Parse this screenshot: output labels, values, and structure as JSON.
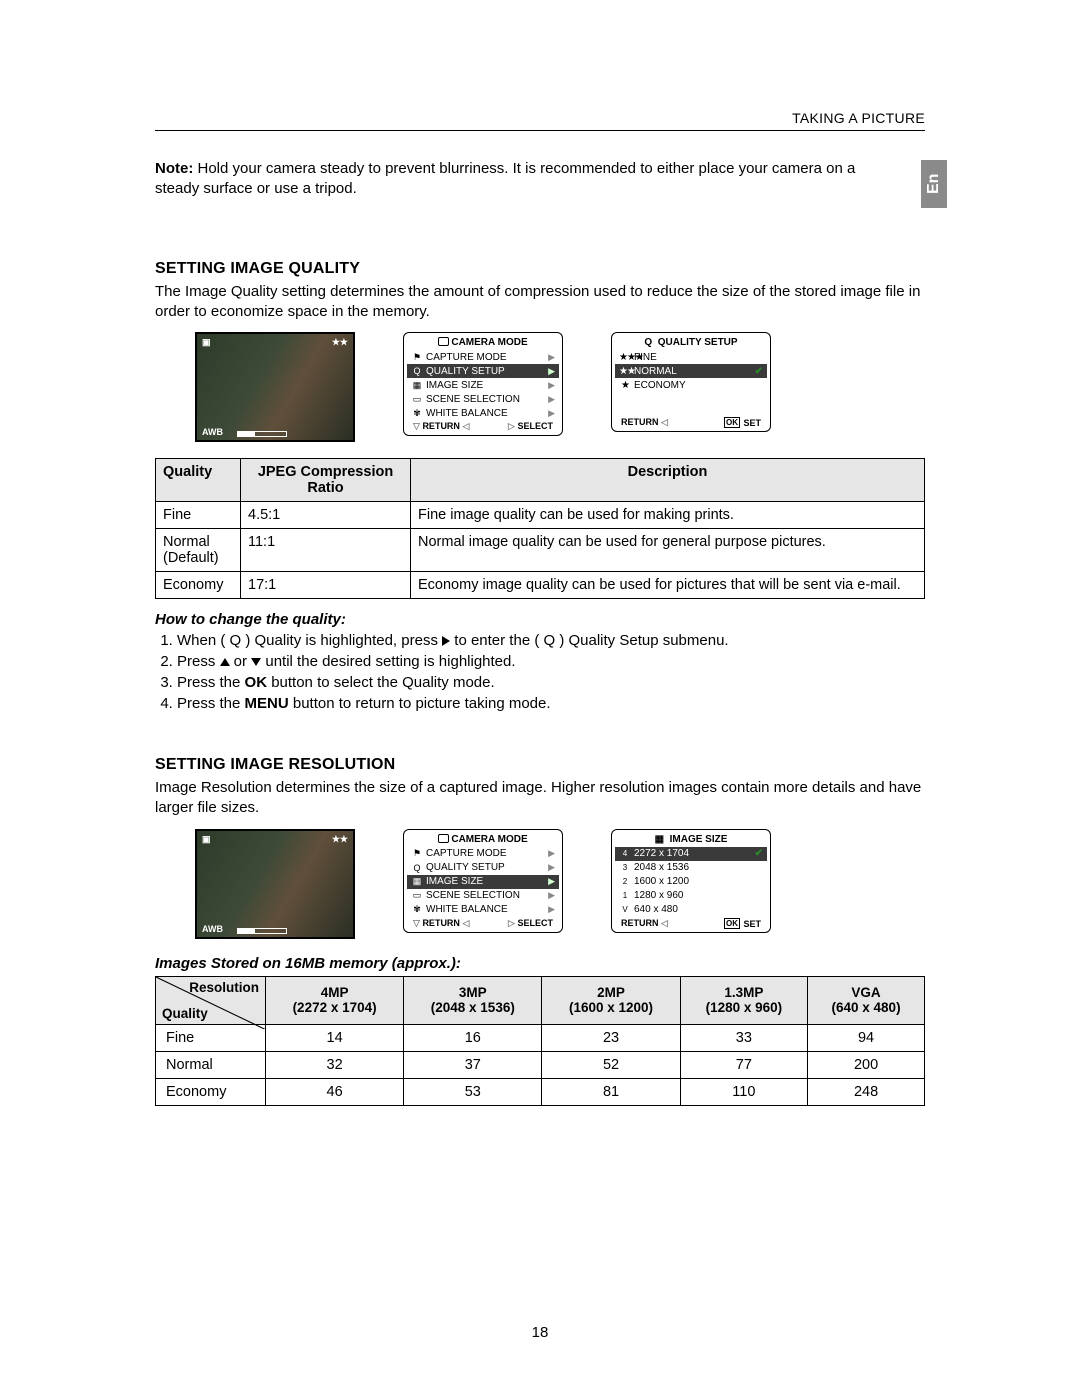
{
  "chapter": "TAKING A PICTURE",
  "lang_tab": "En",
  "note_prefix": "Note:",
  "note_text": " Hold your camera steady to prevent blurriness. It is recommended to either place your camera on a steady surface or use a tripod.",
  "section1_title": "SETTING IMAGE QUALITY",
  "section1_para": "The Image Quality setting determines the amount of compression used to reduce the size of the stored image file in order to economize space in the memory.",
  "lcd_photo": {
    "awb": "AWB",
    "top_left": "",
    "top_right": "★★"
  },
  "menu_camera_title": "CAMERA MODE",
  "menu_camera_items": [
    {
      "icon": "⚑",
      "label": "CAPTURE MODE"
    },
    {
      "icon": "Q",
      "label": "QUALITY SETUP"
    },
    {
      "icon": "▦",
      "label": "IMAGE SIZE"
    },
    {
      "icon": "▭",
      "label": "SCENE SELECTION"
    },
    {
      "icon": "✾",
      "label": "WHITE BALANCE"
    }
  ],
  "menu_camera_highlight_index": 1,
  "menu_foot_left": "RETURN",
  "menu_foot_right": "SELECT",
  "menu_foot_set": "SET",
  "quality_setup_title": "QUALITY  SETUP",
  "quality_setup_prefix": "Q",
  "quality_options": [
    {
      "stars": "★★★",
      "label": "FINE"
    },
    {
      "stars": "★★",
      "label": "NORMAL"
    },
    {
      "stars": "★",
      "label": "ECONOMY"
    }
  ],
  "quality_selected_index": 1,
  "quality_table": {
    "headers": [
      "Quality",
      "JPEG Compression Ratio",
      "Description"
    ],
    "rows": [
      {
        "q": "Fine",
        "r": "4.5:1",
        "d": "Fine image quality can be used for making prints."
      },
      {
        "q": "Normal (Default)",
        "r": "11:1",
        "d": "Normal image quality can be used for general purpose pictures."
      },
      {
        "q": "Economy",
        "r": "17:1",
        "d": "Economy image quality can be used for pictures that will be sent via e-mail."
      }
    ]
  },
  "howto_quality_title": "How to change the quality:",
  "steps_quality": {
    "s1a": "When (  Q  ) Quality is highlighted, press ",
    "s1b": " to enter the (  Q  ) Quality Setup submenu.",
    "s2a": "Press  ",
    "s2b": "  or  ",
    "s2c": "  until the desired setting is highlighted.",
    "s3a": "Press the ",
    "s3b": "OK",
    "s3c": " button to select the Quality mode.",
    "s4a": "Press the ",
    "s4b": "MENU",
    "s4c": " button to return to picture taking mode."
  },
  "section2_title": "SETTING IMAGE RESOLUTION",
  "section2_para": "Image Resolution determines the size of a captured image. Higher resolution images contain more details and have larger file sizes.",
  "menu_camera_highlight_index_b": 2,
  "image_size_title": "IMAGE SIZE",
  "image_size_options": [
    {
      "mp": "4",
      "label": "2272 x 1704"
    },
    {
      "mp": "3",
      "label": "2048 x 1536"
    },
    {
      "mp": "2",
      "label": "1600 x 1200"
    },
    {
      "mp": "1",
      "label": "1280 x 960"
    },
    {
      "mp": "V",
      "label": "640 x 480"
    }
  ],
  "image_size_selected_index": 0,
  "howto_storage_title": "Images Stored on 16MB memory (approx.):",
  "chart_data": {
    "type": "table",
    "diag_res": "Resolution",
    "diag_qual": "Quality",
    "columns": [
      {
        "head": "4MP",
        "sub": "(2272 x 1704)"
      },
      {
        "head": "3MP",
        "sub": "(2048 x 1536)"
      },
      {
        "head": "2MP",
        "sub": "(1600 x 1200)"
      },
      {
        "head": "1.3MP",
        "sub": "(1280 x 960)"
      },
      {
        "head": "VGA",
        "sub": "(640 x 480)"
      }
    ],
    "rows": [
      {
        "label": "Fine",
        "vals": [
          14,
          16,
          23,
          33,
          94
        ]
      },
      {
        "label": "Normal",
        "vals": [
          32,
          37,
          52,
          77,
          200
        ]
      },
      {
        "label": "Economy",
        "vals": [
          46,
          53,
          81,
          110,
          248
        ]
      }
    ]
  },
  "pagenum": "18"
}
